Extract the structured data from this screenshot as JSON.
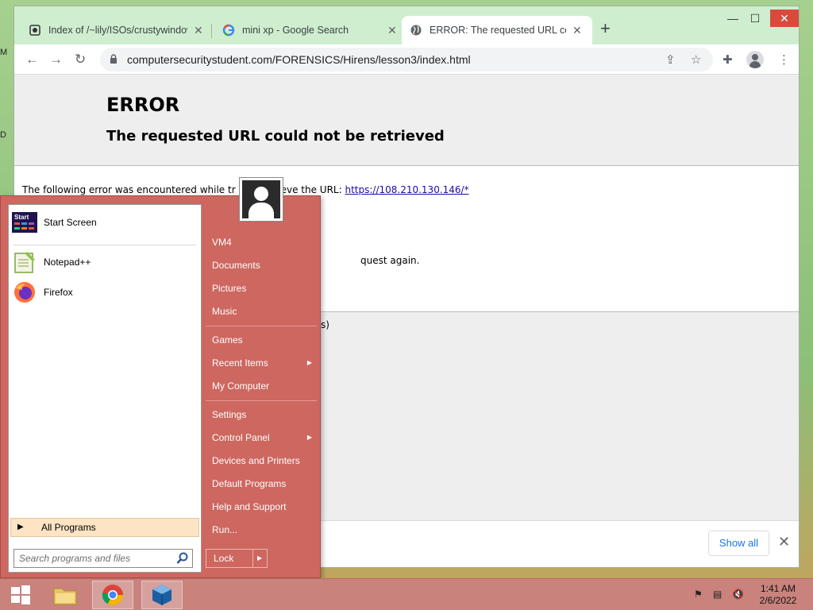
{
  "browser": {
    "tabs": [
      {
        "title": "Index of /~lily/ISOs/crustywindows",
        "icon": "server-icon"
      },
      {
        "title": "mini xp - Google Search",
        "icon": "google-icon"
      },
      {
        "title": "ERROR: The requested URL could not be retrieved",
        "icon": "globe-icon",
        "active": true
      }
    ],
    "url": "computersecuritystudent.com/FORENSICS/Hirens/lesson3/index.html"
  },
  "page": {
    "heading": "ERROR",
    "subheading": "The requested URL could not be retrieved",
    "error_prefix": "The following error was encountered while tr",
    "error_mid": "trieve the URL: ",
    "error_url": "https://108.210.130.146/*",
    "frag_request": "quest again.",
    "frag_paren": "s)"
  },
  "downloads": {
    "show_all": "Show all"
  },
  "start_menu": {
    "pinned": [
      {
        "label": "Start Screen",
        "icon": "start-screen-icon"
      },
      {
        "label": "Notepad++",
        "icon": "notepadpp-icon"
      },
      {
        "label": "Firefox",
        "icon": "firefox-icon"
      }
    ],
    "all_programs": "All Programs",
    "search_placeholder": "Search programs and files",
    "right_items": [
      {
        "label": "VM4"
      },
      {
        "label": "Documents"
      },
      {
        "label": "Pictures"
      },
      {
        "label": "Music"
      },
      {
        "label": "Games"
      },
      {
        "label": "Recent Items",
        "submenu": true
      },
      {
        "label": "My Computer"
      },
      {
        "label": "Settings"
      },
      {
        "label": "Control Panel",
        "submenu": true
      },
      {
        "label": "Devices and Printers"
      },
      {
        "label": "Default Programs"
      },
      {
        "label": "Help and Support"
      },
      {
        "label": "Run..."
      }
    ],
    "lock": "Lock",
    "start_tile_text": "Start"
  },
  "taskbar": {
    "time": "1:41 AM",
    "date": "2/6/2022"
  },
  "desktop": {
    "edge_letters": [
      "M",
      "D"
    ]
  }
}
